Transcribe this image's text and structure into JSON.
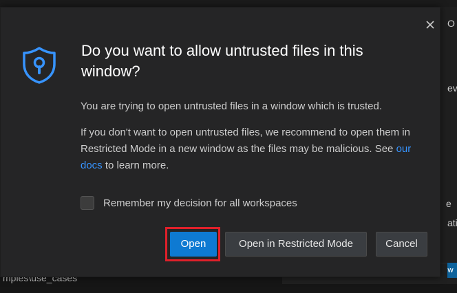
{
  "background": {
    "top_right_text": "O",
    "right_text_1": "ev",
    "right_text_2": "e",
    "right_text_3": "ati",
    "left_text": "/",
    "path_text": "mples\\use_cases",
    "right_button": "w"
  },
  "dialog": {
    "title": "Do you want to allow untrusted files in this window?",
    "message1": "You are trying to open untrusted files in a window which is trusted.",
    "message2_before": "If you don't want to open untrusted files, we recommend to open them in Restricted Mode in a new window as the files may be malicious. See ",
    "message2_link": "our docs",
    "message2_after": " to learn more.",
    "checkbox_label": "Remember my decision for all workspaces",
    "checkbox_checked": false,
    "buttons": {
      "open": "Open",
      "open_restricted": "Open in Restricted Mode",
      "cancel": "Cancel"
    },
    "close_icon": "close-icon",
    "shield_icon": "shield-lock-icon",
    "accent_color": "#3794ff",
    "highlight_color": "#e0202a"
  }
}
